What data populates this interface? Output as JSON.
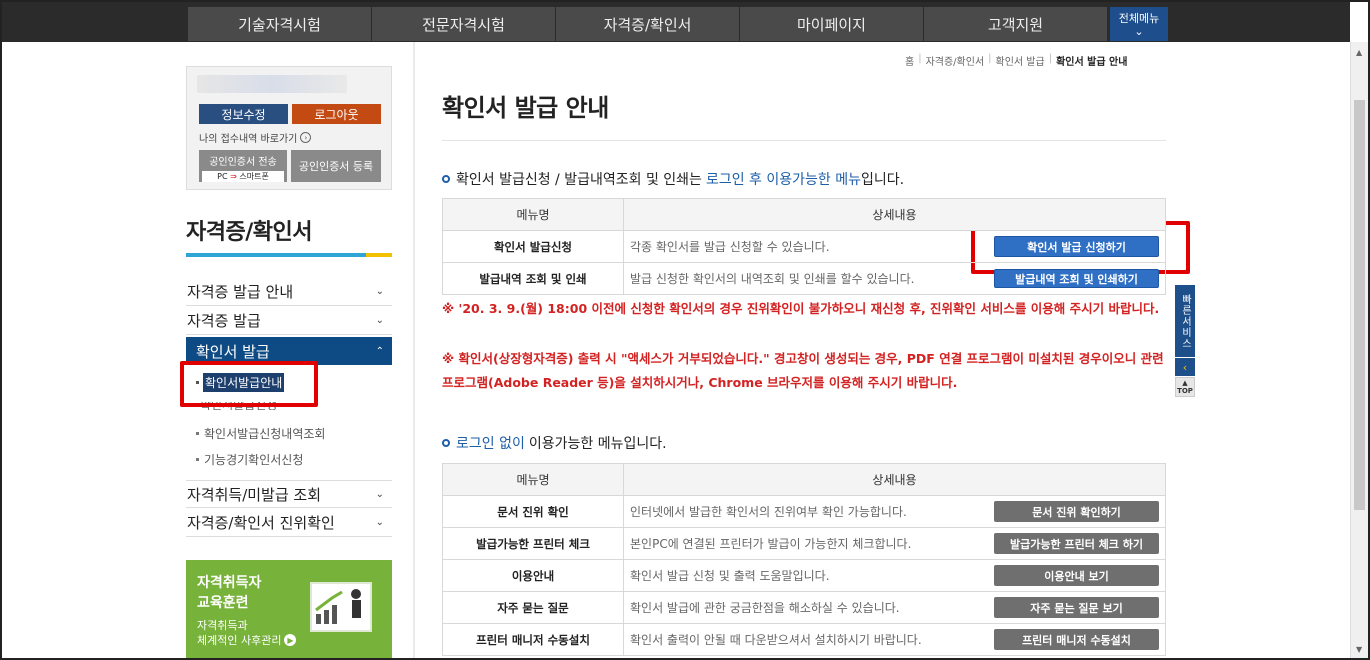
{
  "nav": {
    "items": [
      "기술자격시험",
      "전문자격시험",
      "자격증/확인서",
      "마이페이지",
      "고객지원"
    ],
    "all_menu": "전체메뉴"
  },
  "login": {
    "edit_label": "정보수정",
    "logout_label": "로그아웃",
    "recent_label": "나의 접수내역 바로가기",
    "cert_send_label": "공인인증서 전송",
    "cert_send_pc": "PC",
    "cert_send_phone": "스마트폰",
    "cert_reg_label": "공인인증서 등록"
  },
  "sidebar": {
    "section_title": "자격증/확인서",
    "menus": [
      {
        "label": "자격증 발급 안내"
      },
      {
        "label": "자격증 발급"
      },
      {
        "label": "확인서 발급"
      }
    ],
    "sub_current": "확인서발급안내",
    "sub_hidden": "확인서발급신청",
    "subs": [
      "확인서발급신청내역조회",
      "기능경기확인서신청"
    ],
    "menus_after": [
      {
        "label": "자격취득/미발급 조회"
      },
      {
        "label": "자격증/확인서 진위확인"
      }
    ],
    "banner": {
      "line1": "자격취득자",
      "line2": "교육훈련",
      "line3": "자격취득과",
      "line4": "체계적인 사후관리"
    }
  },
  "breadcrumb": [
    "홈",
    "자격증/확인서",
    "확인서 발급",
    "확인서 발급 안내"
  ],
  "page_title": "확인서 발급 안내",
  "section1": {
    "head_pre": "확인서 발급신청 / 발급내역조회 및 인쇄는",
    "head_blue": "로그인 후 이용가능한 메뉴",
    "head_post": "입니다.",
    "col_name": "메뉴명",
    "col_desc": "상세내용",
    "rows": [
      {
        "name": "확인서 발급신청",
        "desc": "각종 확인서를 발급 신청할 수 있습니다.",
        "button": "확인서 발급 신청하기"
      },
      {
        "name": "발급내역 조회 및 인쇄",
        "desc": "발급 신청한 확인서의 내역조회 및 인쇄를 할수 있습니다.",
        "button": "발급내역 조회 및 인쇄하기"
      }
    ]
  },
  "notices": [
    "※ '20. 3. 9.(월) 18:00 이전에 신청한 확인서의 경우 진위확인이 불가하오니 재신청 후, 진위확인 서비스를 이용해 주시기 바랍니다.",
    "※ 확인서(상장형자격증) 출력 시 \"액세스가 거부되었습니다.\" 경고창이 생성되는 경우, PDF 연결 프로그램이 미설치된 경우이오니 관련 프로그램(Adobe Reader 등)을 설치하시거나, Chrome 브라우저를 이용해 주시기 바랍니다."
  ],
  "section2": {
    "head_blue": "로그인 없이",
    "head_post": "이용가능한 메뉴입니다.",
    "col_name": "메뉴명",
    "col_desc": "상세내용",
    "rows": [
      {
        "name": "문서 진위 확인",
        "desc": "인터넷에서 발급한 확인서의 진위여부 확인 가능합니다.",
        "button": "문서 진위 확인하기"
      },
      {
        "name": "발급가능한 프린터 체크",
        "desc": "본인PC에 연결된 프린터가 발급이 가능한지 체크합니다.",
        "button": "발급가능한 프린터 체크 하기"
      },
      {
        "name": "이용안내",
        "desc": "확인서 발급 신청 및 출력 도움말입니다.",
        "button": "이용안내 보기"
      },
      {
        "name": "자주 묻는 질문",
        "desc": "확인서 발급에 관한 궁금한점을 해소하실 수 있습니다.",
        "button": "자주 묻는 질문 보기"
      },
      {
        "name": "프린터 매니저 수동설치",
        "desc": "확인서 출력이 안될 때 다운받으셔서 설치하시기 바랍니다.",
        "button": "프린터 매니저 수동설치"
      }
    ]
  },
  "quick": {
    "label": "빠른서비스",
    "top": "TOP"
  },
  "colors": {
    "nav_bg": "#2b2b2b",
    "accent_blue": "#0e4b85",
    "notice_red": "#d32222",
    "highlight_red": "#e00000"
  }
}
